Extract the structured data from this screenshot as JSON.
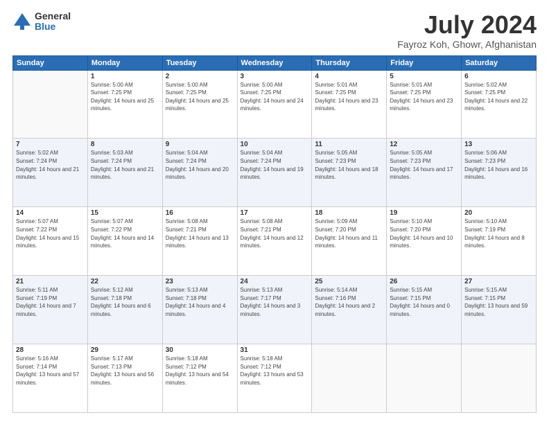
{
  "logo": {
    "general": "General",
    "blue": "Blue"
  },
  "header": {
    "title": "July 2024",
    "location": "Fayroz Koh, Ghowr, Afghanistan"
  },
  "days_of_week": [
    "Sunday",
    "Monday",
    "Tuesday",
    "Wednesday",
    "Thursday",
    "Friday",
    "Saturday"
  ],
  "weeks": [
    [
      {
        "day": "",
        "sunrise": "",
        "sunset": "",
        "daylight": ""
      },
      {
        "day": "1",
        "sunrise": "5:00 AM",
        "sunset": "7:25 PM",
        "daylight": "14 hours and 25 minutes."
      },
      {
        "day": "2",
        "sunrise": "5:00 AM",
        "sunset": "7:25 PM",
        "daylight": "14 hours and 25 minutes."
      },
      {
        "day": "3",
        "sunrise": "5:00 AM",
        "sunset": "7:25 PM",
        "daylight": "14 hours and 24 minutes."
      },
      {
        "day": "4",
        "sunrise": "5:01 AM",
        "sunset": "7:25 PM",
        "daylight": "14 hours and 23 minutes."
      },
      {
        "day": "5",
        "sunrise": "5:01 AM",
        "sunset": "7:25 PM",
        "daylight": "14 hours and 23 minutes."
      },
      {
        "day": "6",
        "sunrise": "5:02 AM",
        "sunset": "7:25 PM",
        "daylight": "14 hours and 22 minutes."
      }
    ],
    [
      {
        "day": "7",
        "sunrise": "5:02 AM",
        "sunset": "7:24 PM",
        "daylight": "14 hours and 21 minutes."
      },
      {
        "day": "8",
        "sunrise": "5:03 AM",
        "sunset": "7:24 PM",
        "daylight": "14 hours and 21 minutes."
      },
      {
        "day": "9",
        "sunrise": "5:04 AM",
        "sunset": "7:24 PM",
        "daylight": "14 hours and 20 minutes."
      },
      {
        "day": "10",
        "sunrise": "5:04 AM",
        "sunset": "7:24 PM",
        "daylight": "14 hours and 19 minutes."
      },
      {
        "day": "11",
        "sunrise": "5:05 AM",
        "sunset": "7:23 PM",
        "daylight": "14 hours and 18 minutes."
      },
      {
        "day": "12",
        "sunrise": "5:05 AM",
        "sunset": "7:23 PM",
        "daylight": "14 hours and 17 minutes."
      },
      {
        "day": "13",
        "sunrise": "5:06 AM",
        "sunset": "7:23 PM",
        "daylight": "14 hours and 16 minutes."
      }
    ],
    [
      {
        "day": "14",
        "sunrise": "5:07 AM",
        "sunset": "7:22 PM",
        "daylight": "14 hours and 15 minutes."
      },
      {
        "day": "15",
        "sunrise": "5:07 AM",
        "sunset": "7:22 PM",
        "daylight": "14 hours and 14 minutes."
      },
      {
        "day": "16",
        "sunrise": "5:08 AM",
        "sunset": "7:21 PM",
        "daylight": "14 hours and 13 minutes."
      },
      {
        "day": "17",
        "sunrise": "5:08 AM",
        "sunset": "7:21 PM",
        "daylight": "14 hours and 12 minutes."
      },
      {
        "day": "18",
        "sunrise": "5:09 AM",
        "sunset": "7:20 PM",
        "daylight": "14 hours and 11 minutes."
      },
      {
        "day": "19",
        "sunrise": "5:10 AM",
        "sunset": "7:20 PM",
        "daylight": "14 hours and 10 minutes."
      },
      {
        "day": "20",
        "sunrise": "5:10 AM",
        "sunset": "7:19 PM",
        "daylight": "14 hours and 8 minutes."
      }
    ],
    [
      {
        "day": "21",
        "sunrise": "5:11 AM",
        "sunset": "7:19 PM",
        "daylight": "14 hours and 7 minutes."
      },
      {
        "day": "22",
        "sunrise": "5:12 AM",
        "sunset": "7:18 PM",
        "daylight": "14 hours and 6 minutes."
      },
      {
        "day": "23",
        "sunrise": "5:13 AM",
        "sunset": "7:18 PM",
        "daylight": "14 hours and 4 minutes."
      },
      {
        "day": "24",
        "sunrise": "5:13 AM",
        "sunset": "7:17 PM",
        "daylight": "14 hours and 3 minutes."
      },
      {
        "day": "25",
        "sunrise": "5:14 AM",
        "sunset": "7:16 PM",
        "daylight": "14 hours and 2 minutes."
      },
      {
        "day": "26",
        "sunrise": "5:15 AM",
        "sunset": "7:15 PM",
        "daylight": "14 hours and 0 minutes."
      },
      {
        "day": "27",
        "sunrise": "5:15 AM",
        "sunset": "7:15 PM",
        "daylight": "13 hours and 59 minutes."
      }
    ],
    [
      {
        "day": "28",
        "sunrise": "5:16 AM",
        "sunset": "7:14 PM",
        "daylight": "13 hours and 57 minutes."
      },
      {
        "day": "29",
        "sunrise": "5:17 AM",
        "sunset": "7:13 PM",
        "daylight": "13 hours and 56 minutes."
      },
      {
        "day": "30",
        "sunrise": "5:18 AM",
        "sunset": "7:12 PM",
        "daylight": "13 hours and 54 minutes."
      },
      {
        "day": "31",
        "sunrise": "5:18 AM",
        "sunset": "7:12 PM",
        "daylight": "13 hours and 53 minutes."
      },
      {
        "day": "",
        "sunrise": "",
        "sunset": "",
        "daylight": ""
      },
      {
        "day": "",
        "sunrise": "",
        "sunset": "",
        "daylight": ""
      },
      {
        "day": "",
        "sunrise": "",
        "sunset": "",
        "daylight": ""
      }
    ]
  ]
}
